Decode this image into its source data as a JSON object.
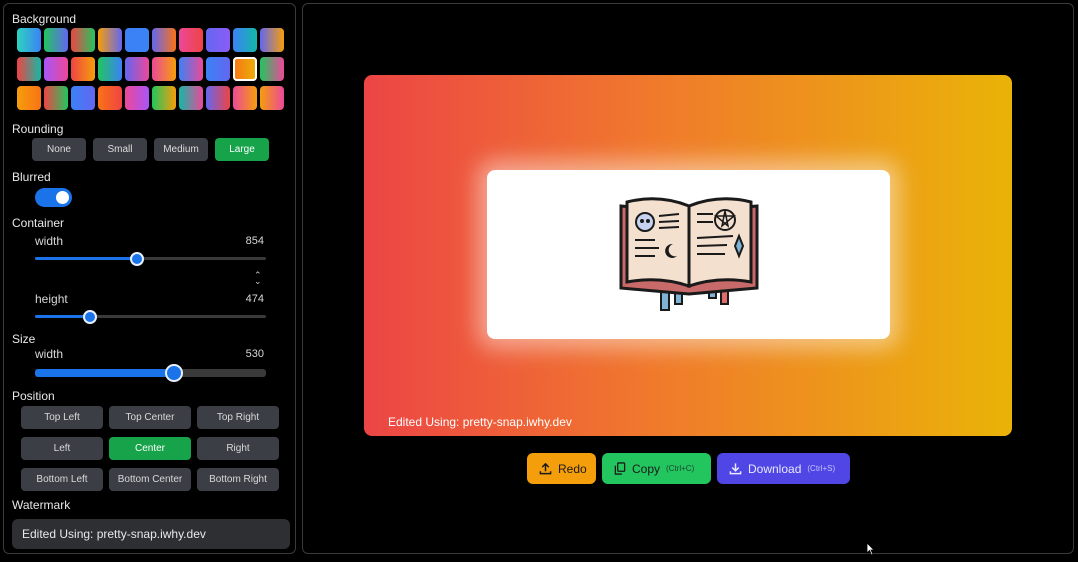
{
  "sidebar": {
    "background_label": "Background",
    "swatch_rows": [
      [
        [
          "#2dd4bf",
          "#3b82f6"
        ],
        [
          "#22c55e",
          "#6366f1"
        ],
        [
          "#ef4444",
          "#22c55e"
        ],
        [
          "#f59e0b",
          "#6366f1"
        ],
        [
          "#3b82f6",
          "#3b82f6"
        ],
        [
          "#6366f1",
          "#f97316"
        ],
        [
          "#ec4899",
          "#ef4444"
        ],
        [
          "#6366f1",
          "#8b5cf6"
        ],
        [
          "#3b82f6",
          "#14b8a6"
        ],
        [
          "#6366f1",
          "#f59e0b"
        ]
      ],
      [
        [
          "#ef4444",
          "#14b8a6"
        ],
        [
          "#a855f7",
          "#ec4899"
        ],
        [
          "#ef4444",
          "#f59e0b"
        ],
        [
          "#22c55e",
          "#3b82f6"
        ],
        [
          "#6366f1",
          "#ec4899"
        ],
        [
          "#ec4899",
          "#f59e0b"
        ],
        [
          "#3b82f6",
          "#ec4899"
        ],
        [
          "#3b82f6",
          "#6366f1"
        ],
        [
          "#f97316",
          "#eab308"
        ],
        [
          "#22c55e",
          "#ec4899"
        ]
      ],
      [
        [
          "#f59e0b",
          "#f97316"
        ],
        [
          "#ef4444",
          "#22c55e"
        ],
        [
          "#3b82f6",
          "#6366f1"
        ],
        [
          "#f97316",
          "#ef4444"
        ],
        [
          "#ec4899",
          "#a855f7"
        ],
        [
          "#22c55e",
          "#f59e0b"
        ],
        [
          "#14b8a6",
          "#ec4899"
        ],
        [
          "#6366f1",
          "#ef4444"
        ],
        [
          "#ec4899",
          "#f59e0b"
        ],
        [
          "#f59e0b",
          "#ec4899"
        ]
      ]
    ],
    "selected_swatch": [
      1,
      8
    ],
    "rounding_label": "Rounding",
    "rounding_options": [
      "None",
      "Small",
      "Medium",
      "Large"
    ],
    "rounding_selected": "Large",
    "blurred_label": "Blurred",
    "blurred_on": true,
    "container_label": "Container",
    "container_width_label": "width",
    "container_width_value": "854",
    "container_width_fraction": 0.44,
    "container_height_label": "height",
    "container_height_value": "474",
    "container_height_fraction": 0.24,
    "size_label": "Size",
    "size_width_label": "width",
    "size_width_value": "530",
    "size_width_fraction": 0.6,
    "position_label": "Position",
    "position_options": [
      "Top Left",
      "Top Center",
      "Top Right",
      "Left",
      "Center",
      "Right",
      "Bottom Left",
      "Bottom Center",
      "Bottom Right"
    ],
    "position_selected": "Center",
    "watermark_label": "Watermark",
    "watermark_value": "Edited Using: pretty-snap.iwhy.dev"
  },
  "preview": {
    "gradient": [
      "#ec4545",
      "#f07a2c",
      "#eab308"
    ],
    "watermark_text": "Edited Using: pretty-snap.iwhy.dev"
  },
  "actions": {
    "redo_label": "Redo",
    "copy_label": "Copy",
    "copy_shortcut": "(Ctrl+C)",
    "download_label": "Download",
    "download_shortcut": "(Ctrl+S)"
  }
}
